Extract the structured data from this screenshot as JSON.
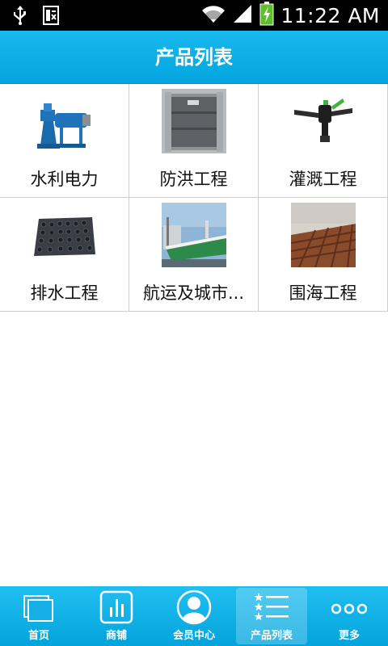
{
  "status_bar": {
    "time": "11:22 AM",
    "icons": [
      "usb-icon",
      "doc-icon",
      "wifi-icon",
      "signal-icon",
      "battery-charging-icon"
    ]
  },
  "header": {
    "title": "产品列表"
  },
  "products": [
    {
      "label": "水利电力",
      "image": "hydraulic-motor-image"
    },
    {
      "label": "防洪工程",
      "image": "flood-gate-image"
    },
    {
      "label": "灌溉工程",
      "image": "sprinkler-image"
    },
    {
      "label": "排水工程",
      "image": "drainage-board-image"
    },
    {
      "label": "航运及城市...",
      "image": "cargo-ship-image"
    },
    {
      "label": "围海工程",
      "image": "sea-wall-image"
    }
  ],
  "bottom_nav": {
    "items": [
      {
        "label": "首页",
        "icon": "home-pages-icon"
      },
      {
        "label": "商铺",
        "icon": "shop-chart-icon"
      },
      {
        "label": "会员中心",
        "icon": "member-avatar-icon"
      },
      {
        "label": "产品列表",
        "icon": "star-list-icon",
        "active": true
      },
      {
        "label": "更多",
        "icon": "more-dots-icon"
      }
    ]
  },
  "colors": {
    "accent": "#02a5df",
    "status_bar": "#000000",
    "battery": "#5fbf2a"
  }
}
